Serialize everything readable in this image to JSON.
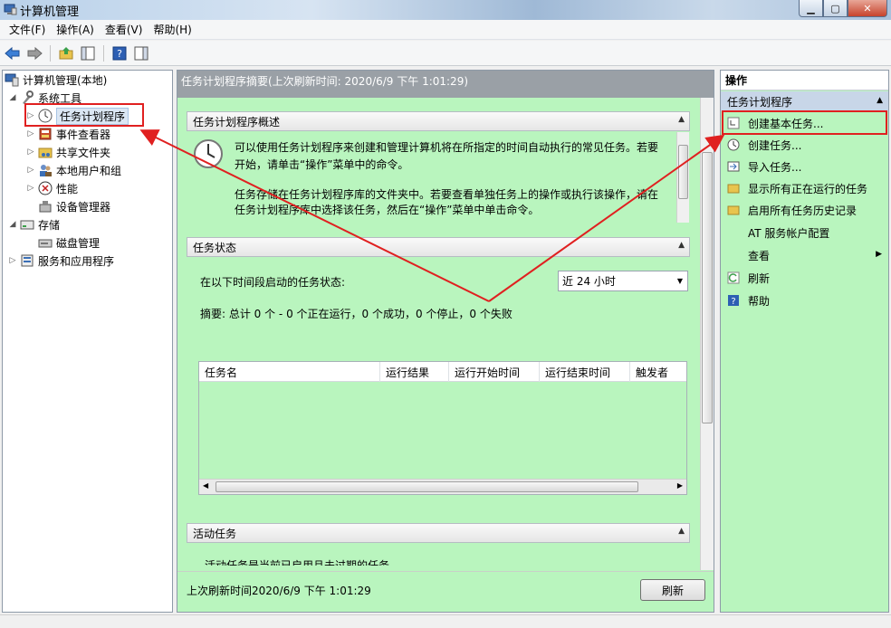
{
  "window": {
    "title": "计算机管理"
  },
  "menu": [
    "文件(F)",
    "操作(A)",
    "查看(V)",
    "帮助(H)"
  ],
  "tree": {
    "root": "计算机管理(本地)",
    "system_tools": "系统工具",
    "task_scheduler": "任务计划程序",
    "event_viewer": "事件查看器",
    "shared_folders": "共享文件夹",
    "local_users": "本地用户和组",
    "performance": "性能",
    "device_manager": "设备管理器",
    "storage": "存储",
    "disk_management": "磁盘管理",
    "services_apps": "服务和应用程序"
  },
  "center": {
    "header": "任务计划程序摘要(上次刷新时间: 2020/6/9 下午 1:01:29)",
    "overview": {
      "title": "任务计划程序概述",
      "para1_line1": "可以使用任务计划程序来创建和管理计算机将在所指定的时间自动执行的常见任务。若要",
      "para1_line2": "开始，请单击“操作”菜单中的命令。",
      "para2_line1": "任务存储在任务计划程序库的文件夹中。若要查看单独任务上的操作或执行该操作，请在",
      "para2_line2": "任务计划程序库中选择该任务，然后在“操作”菜单中单击命令。"
    },
    "status": {
      "title": "任务状态",
      "period_label": "在以下时间段启动的任务状态:",
      "period_value": "近 24 小时",
      "summary": "摘要: 总计 0 个 - 0 个正在运行，0 个成功，0 个停止，0 个失败",
      "columns": [
        "任务名",
        "运行结果",
        "运行开始时间",
        "运行结束时间",
        "触发者"
      ]
    },
    "active": {
      "title": "活动任务",
      "partial_text": "活动任务是当前已启用且未过期的任务。"
    },
    "footer": {
      "last_refresh": "上次刷新时间2020/6/9 下午 1:01:29",
      "refresh_button": "刷新"
    }
  },
  "actions": {
    "title": "操作",
    "group": "任务计划程序",
    "items": [
      "创建基本任务...",
      "创建任务...",
      "导入任务...",
      "显示所有正在运行的任务",
      "启用所有任务历史记录",
      "AT 服务帐户配置",
      "查看",
      "刷新",
      "帮助"
    ]
  },
  "colors": {
    "panel_green": "#b9f5be",
    "highlight_red": "#e02020"
  }
}
